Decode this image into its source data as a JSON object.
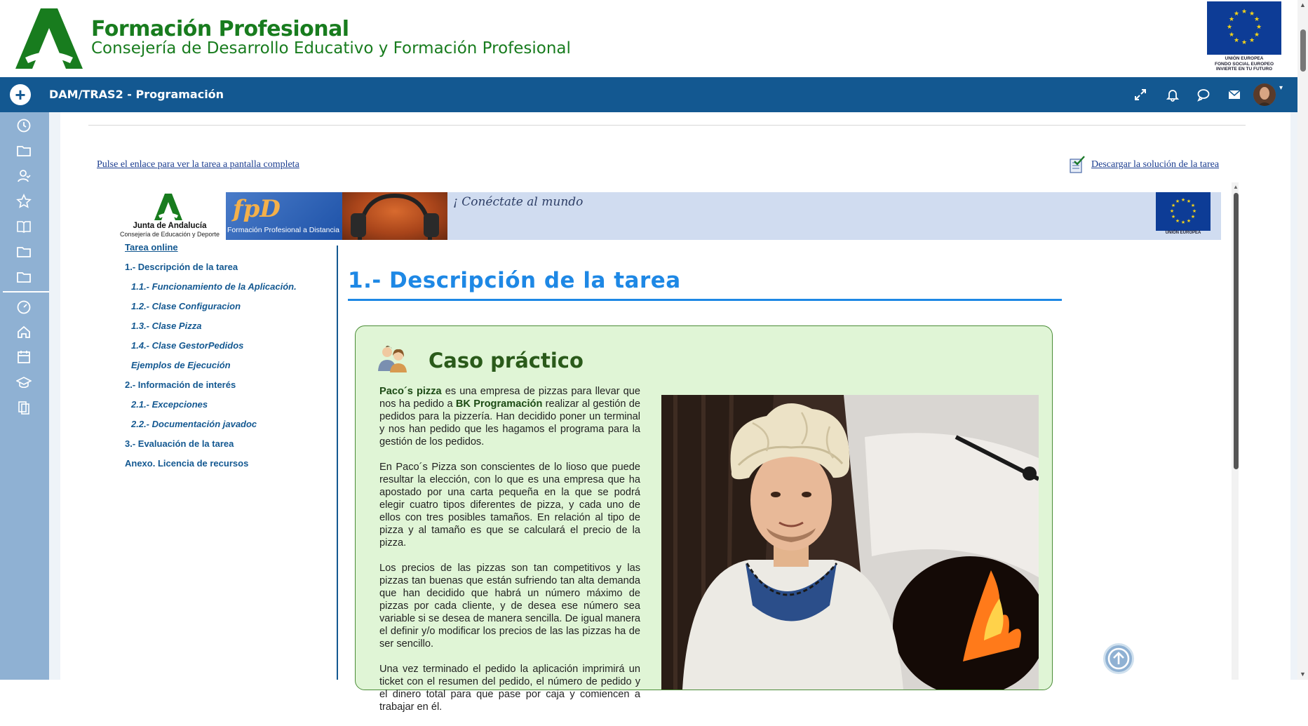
{
  "header": {
    "brand_title": "Formación Profesional",
    "brand_subtitle": "Consejería de Desarrollo Educativo y Formación Profesional",
    "eu_text_1": "UNIÓN EUROPEA",
    "eu_text_2": "FONDO SOCIAL EUROPEO",
    "eu_text_3": "INVIERTE EN TU FUTURO"
  },
  "navbar": {
    "add_label": "+",
    "course_title": "DAM/TRAS2 - Programación",
    "icons": [
      "fullscreen-icon",
      "bell-icon",
      "chat-icon",
      "mail-icon"
    ]
  },
  "sidebar": {
    "icons": [
      "clock-icon",
      "folder-icon",
      "users-icon",
      "star-icon",
      "book-icon",
      "folder-icon",
      "folder-icon",
      "dashboard-icon",
      "home-icon",
      "calendar-icon",
      "graduation-icon",
      "archive-icon"
    ]
  },
  "content": {
    "link_full": "Pulse el enlace para ver la tarea a pantalla completa",
    "link_solution": "Descargar la solución de la tarea"
  },
  "banner": {
    "junta_name": "Junta de Andalucía",
    "junta_sub": "Consejería de Educación y Deporte",
    "fpd_logo": "fpD",
    "fpd_text": "Formación Profesional a Distancia",
    "connect_text": "¡ Conéctate al mundo",
    "eu_text": "UNIÓN EUROPEA"
  },
  "toc": [
    {
      "label": "Tarea online",
      "level": 0
    },
    {
      "label": "1.- Descripción de la tarea",
      "level": 0
    },
    {
      "label": "1.1.- Funcionamiento de la Aplicación.",
      "level": 1
    },
    {
      "label": "1.2.- Clase Configuracion",
      "level": 1
    },
    {
      "label": "1.3.- Clase Pizza",
      "level": 1
    },
    {
      "label": "1.4.- Clase GestorPedidos",
      "level": 1
    },
    {
      "label": "Ejemplos de Ejecución",
      "level": 1
    },
    {
      "label": "2.- Información de interés",
      "level": 0
    },
    {
      "label": "2.1.- Excepciones",
      "level": 1
    },
    {
      "label": "2.2.- Documentación javadoc",
      "level": 1
    },
    {
      "label": "3.- Evaluación de la tarea",
      "level": 0
    },
    {
      "label": "Anexo. Licencia de recursos",
      "level": 0
    }
  ],
  "section": {
    "title": "1.- Descripción de la tarea"
  },
  "case": {
    "title": "Caso práctico",
    "p1_b1": "Paco´s pizza",
    "p1_t1": " es una empresa de pizzas para llevar que nos ha pedido a ",
    "p1_b2": "BK Programación",
    "p1_t2": " realizar al gestión de pedidos para la pizzería. Han decidido poner un terminal y nos han pedido que les hagamos el programa para la gestión de los pedidos.",
    "p2": "En Paco´s Pizza son conscientes de lo lioso que puede resultar la elección, con lo que es una empresa que ha apostado por una carta pequeña en la que se podrá elegir cuatro tipos diferentes de pizza, y cada uno de ellos con tres posibles tamaños. En relación al tipo de pizza y al tamaño es que se calculará el precio de la pizza.",
    "p3": "Los precios de las pizzas son tan competitivos y las pizzas tan buenas que están sufriendo tan alta demanda que han decidido que habrá un número máximo de pizzas por cada cliente, y de desea ese número sea variable si se desea de manera sencilla. De igual manera el definir y/o modificar los precios de las las pizzas ha de ser sencillo.",
    "p4": "Una vez terminado el pedido la aplicación imprimirá un ticket con el resumen del pedido, el número de pedido y el dinero total para que pase por caja y comiencen a trabajar en él."
  }
}
